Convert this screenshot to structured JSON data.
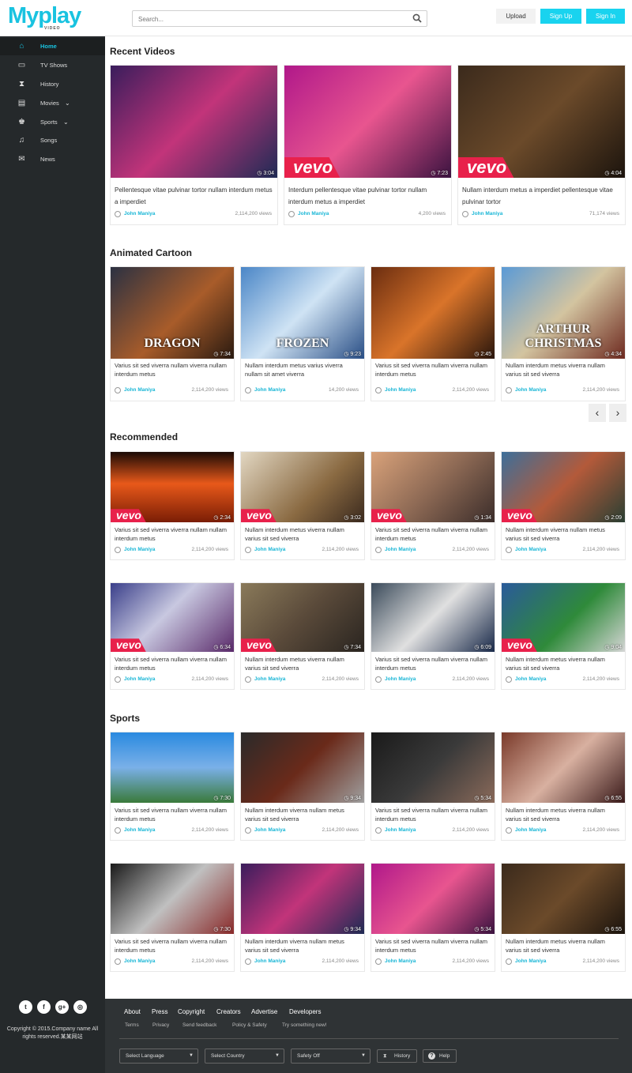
{
  "header": {
    "logo_text": "Myplay",
    "logo_sub": "VIDEO",
    "search_placeholder": "Search...",
    "upload": "Upload",
    "signup": "Sign Up",
    "signin": "Sign In"
  },
  "sidebar": {
    "items": [
      {
        "label": "Home",
        "icon": "home-icon"
      },
      {
        "label": "TV Shows",
        "icon": "tv-icon"
      },
      {
        "label": "History",
        "icon": "hourglass-icon"
      },
      {
        "label": "Movies",
        "icon": "film-icon"
      },
      {
        "label": "Sports",
        "icon": "trophy-icon"
      },
      {
        "label": "Songs",
        "icon": "music-icon"
      },
      {
        "label": "News",
        "icon": "news-icon"
      }
    ],
    "social": [
      "t",
      "f",
      "g+",
      "◎"
    ],
    "copyright": "Copyright © 2015.Company name All rights reserved.某某网站"
  },
  "sections": {
    "recent": "Recent Videos",
    "cartoon": "Animated Cartoon",
    "recommended": "Recommended",
    "sports": "Sports"
  },
  "recent": [
    {
      "title": "Pellentesque vitae pulvinar tortor nullam interdum metus a imperdiet",
      "author": "John Maniya",
      "views": "2,114,200 views",
      "duration": "3:04"
    },
    {
      "title": "Interdum pellentesque vitae pulvinar tortor nullam interdum metus a imperdiet",
      "author": "John Maniya",
      "views": "4,200 views",
      "duration": "7:23",
      "vevo": "vevo"
    },
    {
      "title": "Nullam interdum metus a imperdiet pellentesque vitae pulvinar tortor",
      "author": "John Maniya",
      "views": "71,174 views",
      "duration": "4:04",
      "vevo": "vevo"
    }
  ],
  "cartoon": [
    {
      "title": "Varius sit sed viverra nullam viverra nullam interdum metus",
      "author": "John Maniya",
      "views": "2,114,200 views",
      "duration": "7:34",
      "overlay": "DRAGON"
    },
    {
      "title": "Nullam interdum metus varius viverra nullam sit amet viverra",
      "author": "John Maniya",
      "views": "14,200 views",
      "duration": "9:23",
      "overlay": "FROZEN"
    },
    {
      "title": "Varius sit sed viverra nullam viverra nullam interdum metus",
      "author": "John Maniya",
      "views": "2,114,200 views",
      "duration": "2:45"
    },
    {
      "title": "Nullam interdum metus viverra nullam varius sit sed viverra",
      "author": "John Maniya",
      "views": "2,114,200 views",
      "duration": "4:34",
      "overlay": "ARTHUR CHRISTMAS"
    }
  ],
  "recommended": [
    {
      "title": "Varius sit sed viverra viverra nullam nullam interdum metus",
      "author": "John Maniya",
      "views": "2,114,200 views",
      "duration": "2:34",
      "vevo": "vevo"
    },
    {
      "title": "Nullam interdum metus viverra nullam varius sit sed viverra",
      "author": "John Maniya",
      "views": "2,114,200 views",
      "duration": "3:02",
      "vevo": "vevo"
    },
    {
      "title": "Varius sit sed viverra nullam viverra nullam interdum metus",
      "author": "John Maniya",
      "views": "2,114,200 views",
      "duration": "1:34",
      "vevo": "vevo"
    },
    {
      "title": "Nullam interdum viverra nullam metus varius sit sed viverra",
      "author": "John Maniya",
      "views": "2,114,200 views",
      "duration": "2:09",
      "vevo": "vevo"
    },
    {
      "title": "Varius sit sed viverra nullam viverra nullam interdum metus",
      "author": "John Maniya",
      "views": "2,114,200 views",
      "duration": "6:34",
      "vevo": "vevo"
    },
    {
      "title": "Nullam interdum metus viverra nullam varius sit sed viverra",
      "author": "John Maniya",
      "views": "2,114,200 views",
      "duration": "7:34",
      "vevo": "vevo"
    },
    {
      "title": "Varius sit sed viverra nullam viverra nullam interdum metus",
      "author": "John Maniya",
      "views": "2,114,200 views",
      "duration": "6:09"
    },
    {
      "title": "Nullam interdum metus viverra nullam varius sit sed viverra",
      "author": "John Maniya",
      "views": "2,114,200 views",
      "duration": "9:04",
      "vevo": "vevo"
    }
  ],
  "sports": [
    {
      "title": "Varius sit sed viverra nullam viverra nullam interdum metus",
      "author": "John Maniya",
      "views": "2,114,200 views",
      "duration": "7:30"
    },
    {
      "title": "Nullam interdum viverra nullam metus varius sit sed viverra",
      "author": "John Maniya",
      "views": "2,114,200 views",
      "duration": "9:34"
    },
    {
      "title": "Varius sit sed viverra nullam viverra nullam interdum metus",
      "author": "John Maniya",
      "views": "2,114,200 views",
      "duration": "5:34"
    },
    {
      "title": "Nullam interdum metus viverra nullam varius sit sed viverra",
      "author": "John Maniya",
      "views": "2,114,200 views",
      "duration": "6:55"
    },
    {
      "title": "Varius sit sed viverra nullam viverra nullam interdum metus",
      "author": "John Maniya",
      "views": "2,114,200 views",
      "duration": "7:30"
    },
    {
      "title": "Nullam interdum viverra nullam metus varius sit sed viverra",
      "author": "John Maniya",
      "views": "2,114,200 views",
      "duration": "9:34"
    },
    {
      "title": "Varius sit sed viverra nullam viverra nullam interdum metus",
      "author": "John Maniya",
      "views": "2,114,200 views",
      "duration": "5:34"
    },
    {
      "title": "Nullam interdum metus viverra nullam varius sit sed viverra",
      "author": "John Maniya",
      "views": "2,114,200 views",
      "duration": "6:55"
    }
  ],
  "footer": {
    "links": [
      "About",
      "Press",
      "Copyright",
      "Creators",
      "Advertise",
      "Developers"
    ],
    "sublinks": [
      "Terms",
      "Privacy",
      "Send feedback",
      "Policy & Safety",
      "Try something new!"
    ],
    "selects": [
      "Select Language",
      "Select Country",
      "Safety Off"
    ],
    "history": "History",
    "help": "Help"
  },
  "colors": {
    "accent": "#19c3e0",
    "sidebar": "#25292b",
    "footer": "#2f3335",
    "vevo": "#e8214b"
  }
}
